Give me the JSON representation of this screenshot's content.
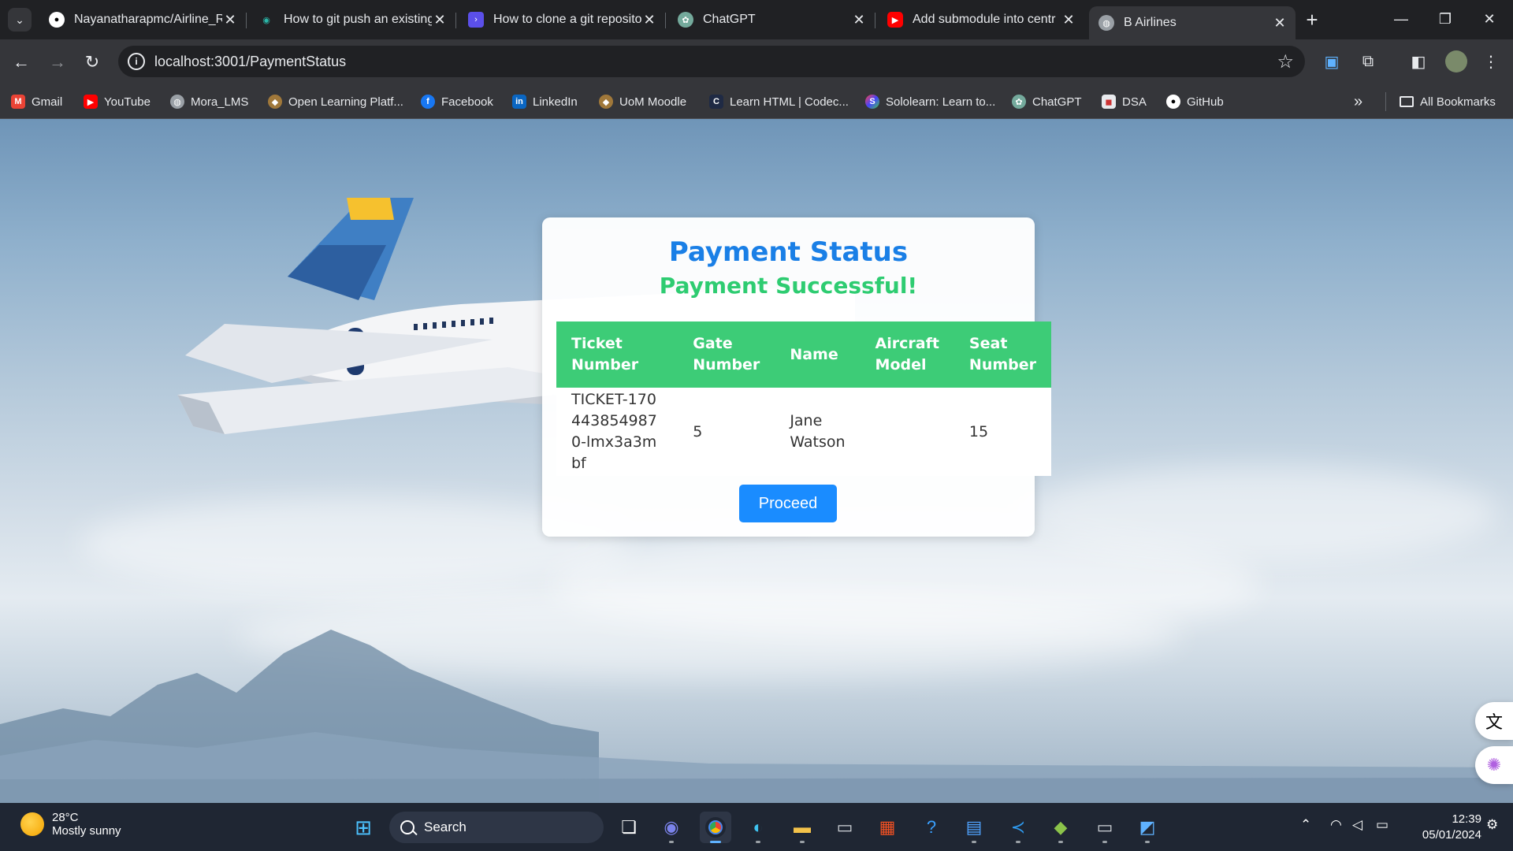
{
  "browser": {
    "tabs": [
      {
        "title": "Nayanatharapmc/Airline_R",
        "favicon": "github-icon"
      },
      {
        "title": "How to git push an existing",
        "favicon": "eye-icon"
      },
      {
        "title": "How to clone a git reposito",
        "favicon": "terminal-icon"
      },
      {
        "title": "ChatGPT",
        "favicon": "chatgpt-icon"
      },
      {
        "title": "Add submodule into centr",
        "favicon": "youtube-icon"
      },
      {
        "title": "B Airlines",
        "favicon": "globe-icon",
        "active": true
      }
    ],
    "url": "localhost:3001/PaymentStatus",
    "bookmarks": [
      {
        "label": "Gmail",
        "icon": "gmail-icon"
      },
      {
        "label": "YouTube",
        "icon": "youtube-icon"
      },
      {
        "label": "Mora_LMS",
        "icon": "globe-icon"
      },
      {
        "label": "Open Learning Platf...",
        "icon": "uom-icon"
      },
      {
        "label": "Facebook",
        "icon": "facebook-icon"
      },
      {
        "label": "LinkedIn",
        "icon": "linkedin-icon"
      },
      {
        "label": "UoM Moodle",
        "icon": "uom-icon"
      },
      {
        "label": "Learn HTML | Codec...",
        "icon": "codecademy-icon"
      },
      {
        "label": "Sololearn: Learn to...",
        "icon": "sololearn-icon"
      },
      {
        "label": "ChatGPT",
        "icon": "chatgpt-icon"
      },
      {
        "label": "DSA",
        "icon": "dsa-icon"
      },
      {
        "label": "GitHub",
        "icon": "github-icon"
      }
    ],
    "all_bookmarks_label": "All Bookmarks"
  },
  "payment": {
    "title": "Payment Status",
    "status": "Payment Successful!",
    "headers": {
      "ticket": "Ticket Number",
      "gate": "Gate Number",
      "name": "Name",
      "aircraft": "Aircraft Model",
      "seat": "Seat Number"
    },
    "row": {
      "ticket": "TICKET-1704438549870-lmx3a3mbf",
      "gate": "5",
      "name": "Jane Watson",
      "aircraft": "",
      "seat": "15"
    },
    "proceed_label": "Proceed"
  },
  "taskbar": {
    "weather_temp": "28°C",
    "weather_desc": "Mostly sunny",
    "search_label": "Search",
    "time": "12:39",
    "date": "05/01/2024"
  },
  "colors": {
    "title": "#1a7fe6",
    "success": "#2ecc71",
    "table_header": "#3dcc77",
    "button": "#1a8cff"
  }
}
